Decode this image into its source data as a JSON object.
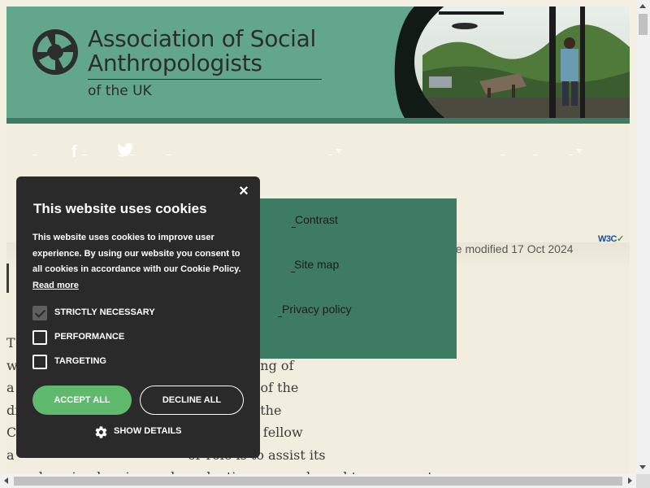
{
  "header": {
    "org_name_line1": "Association of Social",
    "org_name_line2": "Anthropologists",
    "org_name_line3": "of the UK"
  },
  "nav": {
    "facebook_glyph": "f",
    "twitter_icon": "twitter-icon"
  },
  "access_menu": {
    "items": [
      "Contrast",
      "Site map",
      "Privacy policy"
    ]
  },
  "status": {
    "modified_text": "ge modified 17 Oct 2024",
    "w3c_badge": "W3C"
  },
  "body_text": {
    "lines": [
      "T",
      "w                                          and teaching of",
      "a                                          and status of the",
      "di                                         tending to the",
      "C                                          tively with fellow",
      "a                                          or role is to assist its",
      "members in planning and conducting research, and to represent"
    ]
  },
  "cookie_banner": {
    "close_glyph": "×",
    "title": "This website uses cookies",
    "body": "This website uses cookies to improve user experience. By using our website you consent to all cookies in accordance with our Cookie Policy.",
    "read_more": "Read more",
    "options": [
      {
        "label": "STRICTLY NECESSARY",
        "checked": true
      },
      {
        "label": "PERFORMANCE",
        "checked": false
      },
      {
        "label": "TARGETING",
        "checked": false
      }
    ],
    "accept_label": "ACCEPT ALL",
    "decline_label": "DECLINE ALL",
    "details_label": "SHOW DETAILS"
  },
  "colors": {
    "banner_green": "#62a68b",
    "menu_green": "#3e7b63",
    "cookie_bg": "#2a2a2a",
    "accept_green": "#5fba6d",
    "page_bg": "#f1eee0"
  }
}
